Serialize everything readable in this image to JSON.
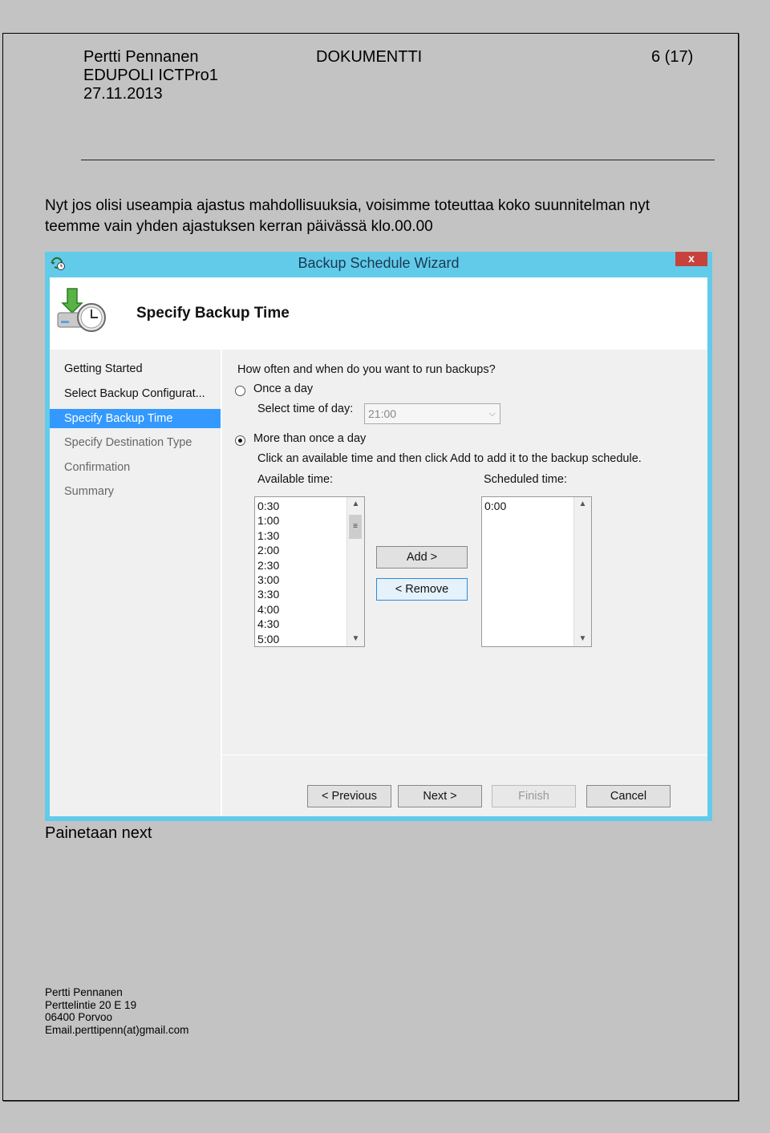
{
  "header": {
    "author": "Pertti Pennanen",
    "org": "EDUPOLI ICTPro1",
    "date": "27.11.2013",
    "doc_type": "DOKUMENTTI",
    "page": "6 (17)"
  },
  "intro_text": "Nyt jos olisi useampia ajastus mahdollisuuksia, voisimme toteuttaa koko suunnitelman nyt teemme vain yhden ajastuksen kerran päivässä klo.00.00",
  "dialog": {
    "title": "Backup Schedule Wizard",
    "close": "x",
    "heading": "Specify Backup Time",
    "nav": [
      "Getting Started",
      "Select Backup Configurat...",
      "Specify Backup Time",
      "Specify Destination Type",
      "Confirmation",
      "Summary"
    ],
    "question": "How often and when do you want to run backups?",
    "once_label": "Once a day",
    "select_time_label": "Select time of day:",
    "select_time_value": "21:00",
    "more_label": "More than once a day",
    "instruction": "Click an available time and then click Add to add it to the backup schedule.",
    "available_label": "Available time:",
    "scheduled_label": "Scheduled time:",
    "available_times": [
      "0:30",
      "1:00",
      "1:30",
      "2:00",
      "2:30",
      "3:00",
      "3:30",
      "4:00",
      "4:30",
      "5:00"
    ],
    "scheduled_times": [
      "0:00"
    ],
    "add_button": "Add >",
    "remove_button": "< Remove",
    "previous_button": "< Previous",
    "next_button": "Next >",
    "finish_button": "Finish",
    "cancel_button": "Cancel"
  },
  "caption": "Painetaan next",
  "footer": {
    "name": "Pertti Pennanen",
    "street": "Perttelintie 20 E 19",
    "city": "06400 Porvoo",
    "email": "Email.perttipenn(at)gmail.com"
  }
}
